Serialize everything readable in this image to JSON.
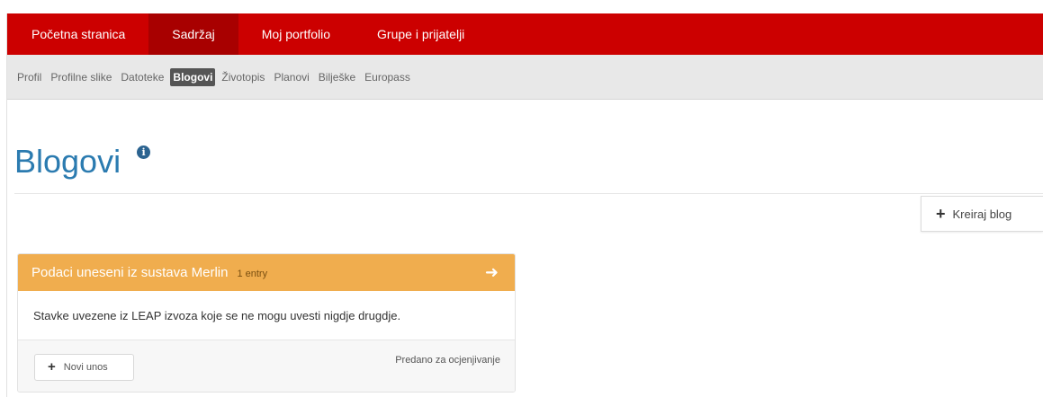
{
  "topnav": {
    "items": [
      {
        "label": "Početna stranica",
        "active": false
      },
      {
        "label": "Sadržaj",
        "active": true
      },
      {
        "label": "Moj portfolio",
        "active": false
      },
      {
        "label": "Grupe i prijatelji",
        "active": false
      }
    ]
  },
  "subnav": {
    "items": [
      {
        "label": "Profil",
        "active": false
      },
      {
        "label": "Profilne slike",
        "active": false
      },
      {
        "label": "Datoteke",
        "active": false
      },
      {
        "label": "Blogovi",
        "active": true
      },
      {
        "label": "Životopis",
        "active": false
      },
      {
        "label": "Planovi",
        "active": false
      },
      {
        "label": "Bilješke",
        "active": false
      },
      {
        "label": "Europass",
        "active": false
      }
    ]
  },
  "page": {
    "title": "Blogovi",
    "info_icon": "info-icon"
  },
  "actions": {
    "create_blog_label": "Kreiraj blog",
    "create_icon": "plus-icon"
  },
  "blog_card": {
    "title": "Podaci uneseni iz sustava Merlin",
    "entry_count": "1 entry",
    "arrow_icon": "arrow-right-icon",
    "description": "Stavke uvezene iz LEAP izvoza koje se ne mogu uvesti nigdje drugdje.",
    "new_entry_label": "Novi unos",
    "status": "Predano za ocjenjivanje"
  },
  "colors": {
    "topnav_bg": "#cc0000",
    "topnav_active_bg": "#a80000",
    "subnav_bg": "#e8e8e8",
    "title_blue": "#2b7bb0",
    "card_header": "#f0ad4e"
  }
}
